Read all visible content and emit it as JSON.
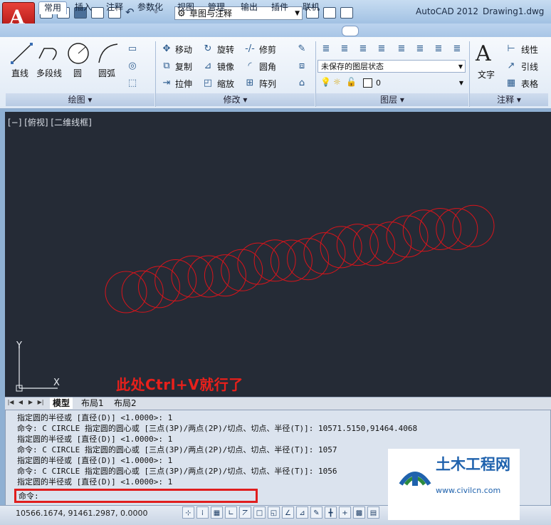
{
  "titlebar": {
    "workspace": "草图与注释",
    "app_name": "AutoCAD 2012",
    "document": "Drawing1.dwg"
  },
  "tabs": [
    "常用",
    "插入",
    "注释",
    "参数化",
    "视图",
    "管理",
    "输出",
    "插件",
    "联机"
  ],
  "active_tab": "常用",
  "ribbon": {
    "draw": {
      "title": "绘图",
      "line": "直线",
      "polyline": "多段线",
      "circle": "圆",
      "arc": "圆弧"
    },
    "modify": {
      "title": "修改",
      "move": "移动",
      "rotate": "旋转",
      "trim": "修剪",
      "copy": "复制",
      "mirror": "镜像",
      "fillet": "圆角",
      "stretch": "拉伸",
      "scale": "缩放",
      "array": "阵列"
    },
    "layers": {
      "title": "图层",
      "layer_state": "未保存的图层状态",
      "current_layer": "0"
    },
    "annotation": {
      "title": "注释",
      "text": "文字",
      "linear": "线性",
      "leader": "引线",
      "table": "表格"
    }
  },
  "viewport": {
    "label": "[−] [俯视] [二维线框]",
    "annotation": "此处Ctrl+V就行了"
  },
  "layout_tabs": [
    "模型",
    "布局1",
    "布局2"
  ],
  "command_history": [
    "指定圆的半径或 [直径(D)] <1.0000>: 1",
    "命令: C CIRCLE 指定圆的圆心或 [三点(3P)/两点(2P)/切点、切点、半径(T)]: 10571.5150,91464.4068",
    "指定圆的半径或 [直径(D)] <1.0000>: 1",
    "命令: C CIRCLE 指定圆的圆心或 [三点(3P)/两点(2P)/切点、切点、半径(T)]: 1057",
    "指定圆的半径或 [直径(D)] <1.0000>: 1",
    "命令: C CIRCLE 指定圆的圆心或 [三点(3P)/两点(2P)/切点、切点、半径(T)]: 1056",
    "指定圆的半径或 [直径(D)] <1.0000>: 1"
  ],
  "command_prompt": "命令:",
  "status": {
    "coordinates": "10566.1674, 91461.2987, 0.0000"
  },
  "watermark": {
    "name": "土木工程网",
    "url": "www.civilcn.com"
  },
  "colors": {
    "canvas": "#252b36",
    "circle": "#d9141b",
    "highlight": "#e01e1e"
  }
}
